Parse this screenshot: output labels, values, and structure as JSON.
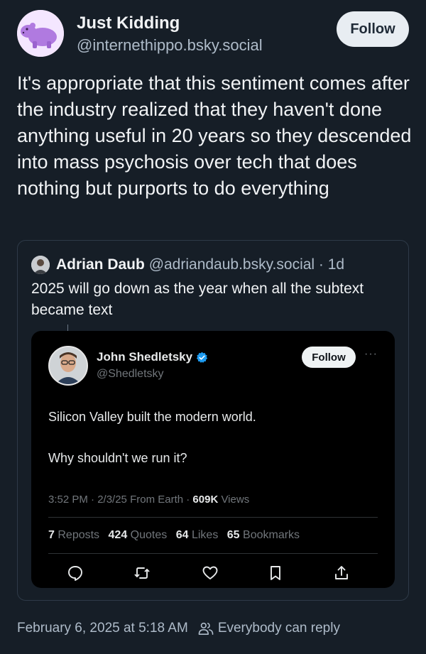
{
  "post": {
    "author_name": "Just Kidding",
    "author_handle": "@internethippo.bsky.social",
    "follow_label": "Follow",
    "text": "It's appropriate that this sentiment comes after the industry realized that they haven't done anything useful in 20 years so they descended into mass psychosis over tech that does nothing but purports to do everything",
    "timestamp": "February 6, 2025 at 5:18 AM",
    "reply_setting": "Everybody can reply"
  },
  "quote": {
    "author_name": "Adrian Daub",
    "author_handle": "@adriandaub.bsky.social",
    "age": "· 1d",
    "text": "2025 will go down as the year when all the subtext became text"
  },
  "embed": {
    "author_name": "John Shedletsky",
    "author_handle": "@Shedletsky",
    "follow_label": "Follow",
    "more": "···",
    "line1": "Silicon Valley built the modern world.",
    "line2": "Why shouldn't we run it?",
    "meta_time": "3:52 PM · 2/3/25 From Earth · ",
    "meta_views_count": "609K",
    "meta_views_label": " Views",
    "stats": [
      {
        "num": "7",
        "label": "Reposts"
      },
      {
        "num": "424",
        "label": "Quotes"
      },
      {
        "num": "64",
        "label": "Likes"
      },
      {
        "num": "65",
        "label": "Bookmarks"
      }
    ],
    "action_icons": [
      "reply-icon",
      "repost-icon",
      "like-icon",
      "bookmark-icon",
      "share-icon"
    ]
  },
  "colors": {
    "background": "#161e27",
    "text": "#f1f3f5",
    "muted": "#aebbc9",
    "embed_background": "#000000",
    "verified_blue": "#1d9bf0",
    "avatar_purple": "#b07ae0"
  }
}
